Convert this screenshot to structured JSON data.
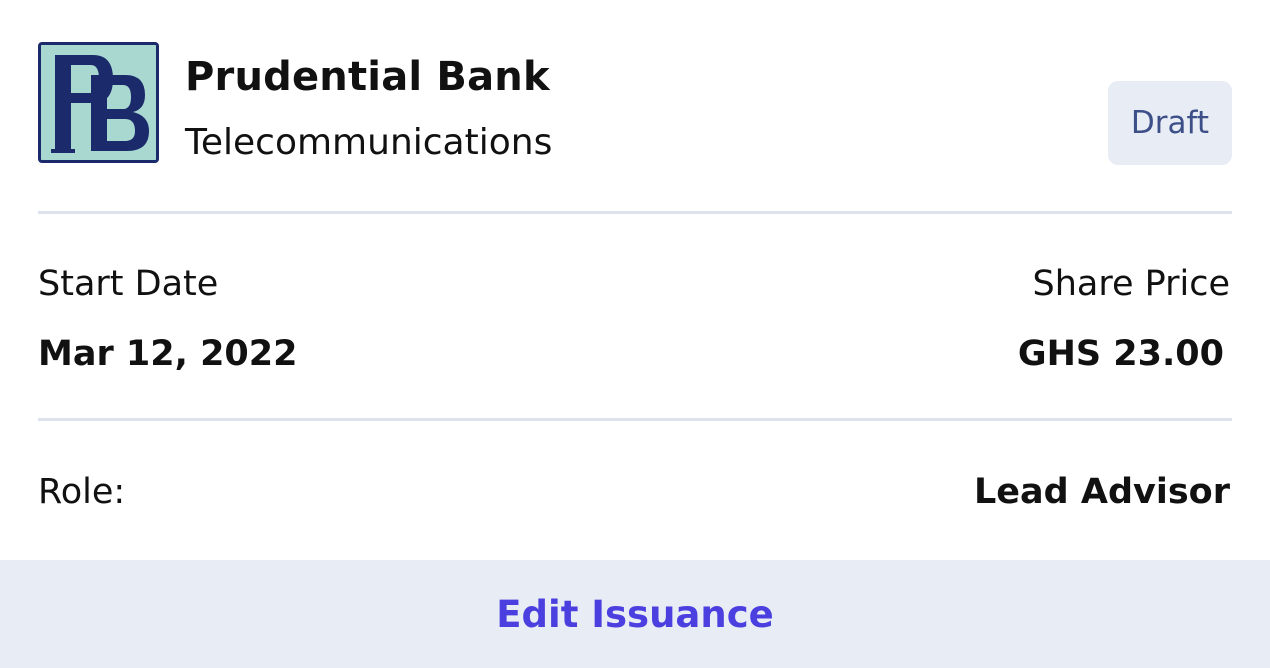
{
  "company": {
    "logo_text": "PB",
    "name": "Prudential Bank",
    "sector": "Telecommunications",
    "status": "Draft"
  },
  "details": {
    "start_date_label": "Start Date",
    "start_date_value": "Mar 12, 2022",
    "share_price_label": "Share Price",
    "share_price_value": "GHS 23.00",
    "role_label": "Role:",
    "role_value": "Lead Advisor"
  },
  "actions": {
    "edit_label": "Edit Issuance"
  },
  "colors": {
    "logo_bg": "#a8d8d0",
    "logo_fg": "#1b2a6b",
    "badge_bg": "#e8ecf4",
    "badge_text": "#3d4f88",
    "footer_bg": "#e8ecf4",
    "action_text": "#4b3fe0",
    "divider": "#dce3ec"
  }
}
